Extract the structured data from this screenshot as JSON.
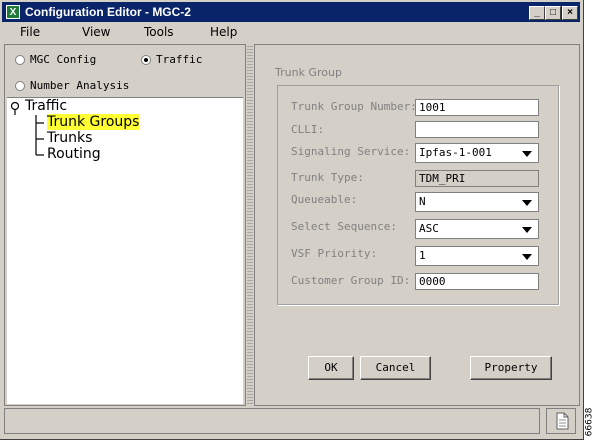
{
  "window": {
    "title": "Configuration Editor - MGC-2",
    "app_icon": "X"
  },
  "titlebar_buttons": {
    "minimize": "_",
    "maximize": "□",
    "close": "×"
  },
  "menu": [
    "File",
    "View",
    "Tools",
    "Help"
  ],
  "modes": [
    {
      "label": "MGC Config",
      "selected": false
    },
    {
      "label": "Traffic",
      "selected": true
    },
    {
      "label": "Number Analysis",
      "selected": false
    }
  ],
  "tree": {
    "root": "Traffic",
    "children": [
      "Trunk Groups",
      "Trunks",
      "Routing"
    ],
    "selected": "Trunk Groups"
  },
  "form": {
    "group_title": "Trunk Group",
    "fields": [
      {
        "label": "Trunk Group Number:",
        "value": "1001",
        "kind": "text"
      },
      {
        "label": "CLLI:",
        "value": "",
        "kind": "text"
      },
      {
        "label": "Signaling Service:",
        "value": "Ipfas-1-001",
        "kind": "select"
      },
      {
        "label": "Trunk Type:",
        "value": "TDM_PRI",
        "kind": "readonly"
      },
      {
        "label": "Queueable:",
        "value": "N",
        "kind": "select"
      },
      {
        "label": "Select Sequence:",
        "value": "ASC",
        "kind": "select"
      },
      {
        "label": "VSF Priority:",
        "value": "1",
        "kind": "select"
      },
      {
        "label": "Customer Group ID:",
        "value": "0000",
        "kind": "text"
      }
    ]
  },
  "buttons": {
    "ok": "OK",
    "cancel": "Cancel",
    "property": "Property"
  },
  "figure_number": "66638",
  "colors": {
    "titlebar": "#0a246a",
    "tree_highlight": "#ffff33",
    "window_bg": "#d4d0c8"
  }
}
